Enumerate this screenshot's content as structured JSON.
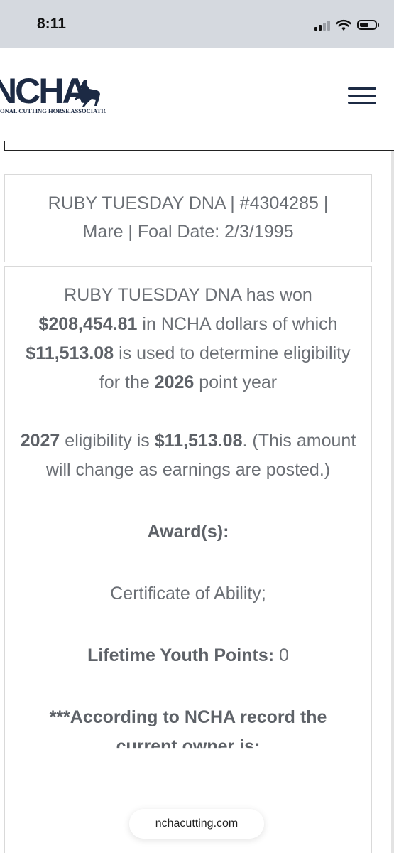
{
  "status_bar": {
    "time": "8:11"
  },
  "header": {
    "logo_letters": "NCHA",
    "logo_tagline": "ONAL CUTTING HORSE ASSOCIATION"
  },
  "horse": {
    "title_line1": "RUBY TUESDAY DNA | #4304285 |",
    "title_line2": "Mare | Foal Date: 2/3/1995"
  },
  "earnings": {
    "name": "RUBY TUESDAY DNA",
    "has_won": "has won",
    "total": "$208,454.81",
    "mid_text": "in NCHA dollars of which",
    "eligible_amount": "$11,513.08",
    "tail_text": "is used to determine eligibility for the",
    "point_year": "2026",
    "end_text": "point year"
  },
  "eligibility": {
    "year": "2027",
    "text": "eligibility is",
    "amount": "$11,513.08",
    "note": ". (This amount will change as earnings are posted.)"
  },
  "awards": {
    "heading": "Award(s):",
    "value": "Certificate of Ability;"
  },
  "youth_points": {
    "label": "Lifetime Youth Points:",
    "value": "0"
  },
  "owner": {
    "line1": "***According to NCHA record the",
    "line2": "current owner is:"
  },
  "browser": {
    "url": "nchacutting.com"
  },
  "colors": {
    "navy": "#1c2a44",
    "text_gray": "#6b6f75",
    "status_bg": "#d5d9df"
  },
  "icons": [
    "cellular-signal-icon",
    "wifi-icon",
    "battery-icon",
    "menu-icon",
    "ncha-logo"
  ]
}
